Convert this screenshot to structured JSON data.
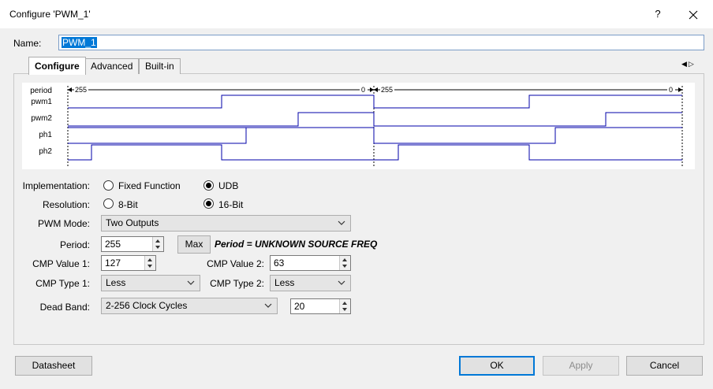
{
  "window": {
    "title": "Configure 'PWM_1'",
    "help_label": "?"
  },
  "name": {
    "label": "Name:",
    "value": "PWM_1"
  },
  "tabs": [
    {
      "label": "Configure",
      "active": true
    },
    {
      "label": "Advanced",
      "active": false
    },
    {
      "label": "Built-in",
      "active": false
    }
  ],
  "waveform": {
    "signals": [
      "period",
      "pwm1",
      "pwm2",
      "ph1",
      "ph2"
    ],
    "period_start": "255",
    "period_end": "0",
    "line_color": "#0000aa"
  },
  "form": {
    "implementation": {
      "label": "Implementation:",
      "options": [
        "Fixed Function",
        "UDB"
      ],
      "selected": "UDB"
    },
    "resolution": {
      "label": "Resolution:",
      "options": [
        "8-Bit",
        "16-Bit"
      ],
      "selected": "16-Bit"
    },
    "pwm_mode": {
      "label": "PWM Mode:",
      "value": "Two Outputs"
    },
    "period": {
      "label": "Period:",
      "value": "255",
      "max_label": "Max",
      "message": "Period = UNKNOWN SOURCE FREQ"
    },
    "cmp_value_1": {
      "label": "CMP Value 1:",
      "value": "127"
    },
    "cmp_value_2": {
      "label": "CMP Value 2:",
      "value": "63"
    },
    "cmp_type_1": {
      "label": "CMP Type 1:",
      "value": "Less"
    },
    "cmp_type_2": {
      "label": "CMP Type 2:",
      "value": "Less"
    },
    "dead_band": {
      "label": "Dead Band:",
      "value": "2-256 Clock Cycles",
      "cycles": "20"
    }
  },
  "buttons": {
    "datasheet": "Datasheet",
    "ok": "OK",
    "apply": "Apply",
    "cancel": "Cancel"
  }
}
